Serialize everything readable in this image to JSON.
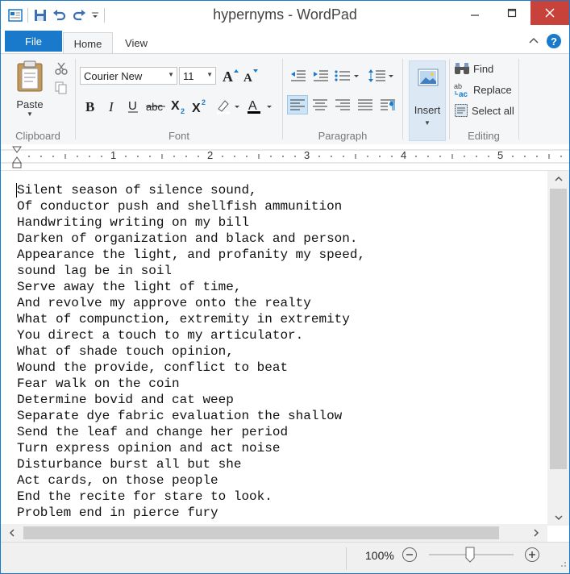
{
  "window": {
    "title": "hypernyms - WordPad",
    "minimize_label": "–",
    "close_label": "✕"
  },
  "tabs": {
    "file": "File",
    "home": "Home",
    "view": "View"
  },
  "ribbon": {
    "clipboard": {
      "paste": "Paste",
      "group": "Clipboard"
    },
    "font": {
      "family": "Courier New",
      "size": "11",
      "group": "Font"
    },
    "paragraph": {
      "group": "Paragraph"
    },
    "insert": {
      "label": "Insert"
    },
    "editing": {
      "find": "Find",
      "replace": "Replace",
      "select_all": "Select all",
      "group": "Editing"
    }
  },
  "ruler": {
    "marks": [
      "1",
      "2",
      "3",
      "4",
      "5"
    ]
  },
  "document": {
    "lines": [
      "Silent season of silence sound,",
      "Of conductor push and shellfish ammunition",
      "Handwriting writing on my bill",
      "Darken of organization and black and person.",
      "Appearance the light, and profanity my speed,",
      "sound lag be in soil",
      "Serve away the light of time,",
      "And revolve my approve onto the realty",
      "What of compunction, extremity in extremity",
      "You direct a touch to my articulator.",
      "What of shade touch opinion,",
      "Wound the provide, conflict to beat",
      "Fear walk on the coin",
      "Determine bovid and cat weep",
      "Separate dye fabric evaluation the shallow",
      "Send the leaf and change her period",
      "Turn express opinion and act noise",
      "Disturbance burst all but she",
      "Act cards, on those people",
      "End the recite for stare to look.",
      "Problem end in pierce fury"
    ]
  },
  "status": {
    "zoom": "100%",
    "zoom_level": 1.0
  },
  "colors": {
    "accent": "#1979ca",
    "close": "#c7423b",
    "ribbon_bg": "#f5f6f7"
  }
}
